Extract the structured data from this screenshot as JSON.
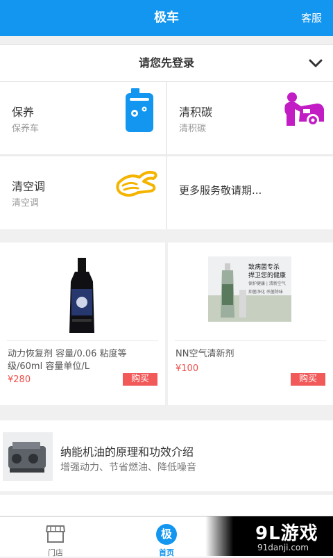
{
  "header": {
    "title": "极车",
    "service_label": "客服"
  },
  "login": {
    "prompt": "请您先登录"
  },
  "services": [
    {
      "name": "保养",
      "sub": "保养车",
      "icon": "oil-can-icon"
    },
    {
      "name": "清积碳",
      "sub": "清积碳",
      "icon": "car-wash-icon"
    },
    {
      "name": "清空调",
      "sub": "清空调",
      "icon": "air-conditioner-icon"
    }
  ],
  "services_more": "更多服务敬请期...",
  "products": [
    {
      "name": "动力恢复剂 容量/0.06 粘度等级/60ml 容量单位/L",
      "price": "¥280",
      "buy_label": "购买",
      "image": "engine-additive-bottle"
    },
    {
      "name": "NN空气清新剂",
      "price": "¥100",
      "buy_label": "购买",
      "image": "air-freshener-spray"
    }
  ],
  "product2_banner": {
    "line1": "致病菌专杀",
    "line2": "捍卫您的健康",
    "line3": "保护健康 | 清新空气",
    "line4": "抑菌净化 杀菌除味"
  },
  "article": {
    "title": "纳能机油的原理和功效介绍",
    "subtitle": "增强动力、节省燃油、降低噪音"
  },
  "tabs": [
    {
      "label": "门店",
      "icon": "store-icon",
      "active": false
    },
    {
      "label": "首页",
      "icon": "home-icon",
      "glyph": "极",
      "active": true
    }
  ],
  "watermark": {
    "brand": "9L游戏",
    "url": "91danji.com"
  },
  "colors": {
    "primary": "#1296f0",
    "buy": "#f25a5a",
    "price": "#f0504b",
    "icon_yellow": "#f4b400",
    "icon_magenta": "#c21cc4"
  }
}
